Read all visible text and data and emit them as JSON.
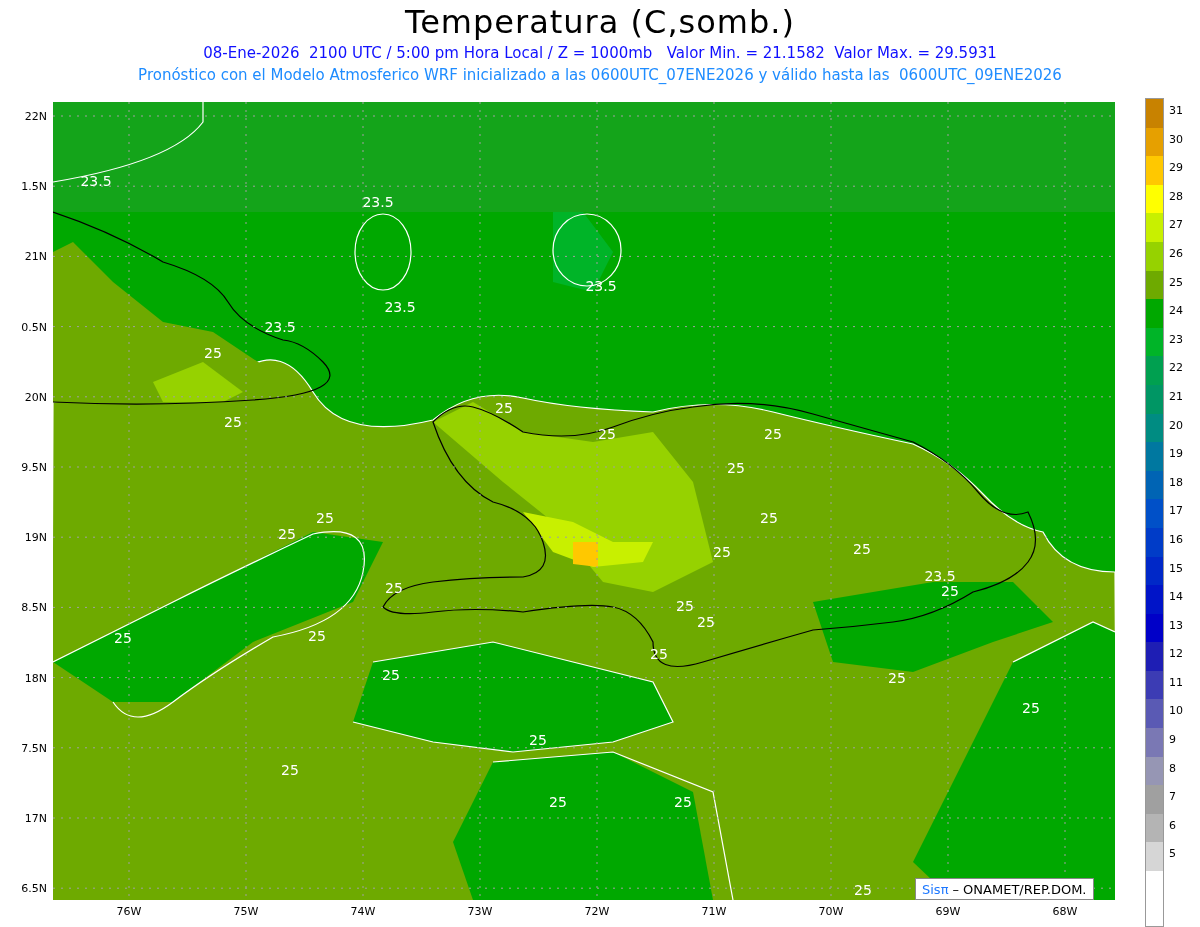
{
  "title": "Temperatura (C,somb.)",
  "subtitle_1": "08-Ene-2026  2100 UTC / 5:00 pm Hora Local / Z = 1000mb   Valor Min. = 21.1582  Valor Max. = 29.5931",
  "subtitle_2": "Pronóstico con el Modelo Atmosferico WRF inicializado a las 0600UTC_07ENE2026 y válido hasta las  0600UTC_09ENE2026",
  "map": {
    "latitude_labels": [
      "22N",
      "1.5N",
      "21N",
      "0.5N",
      "20N",
      "9.5N",
      "19N",
      "8.5N",
      "18N",
      "7.5N",
      "17N",
      "6.5N"
    ],
    "longitude_labels": [
      "76W",
      "75W",
      "74W",
      "73W",
      "72W",
      "71W",
      "70W",
      "69W",
      "68W"
    ],
    "contour_labels": [
      "23.5",
      "23.5",
      "23.5",
      "23.5",
      "23.5",
      "25",
      "25",
      "25",
      "25",
      "25",
      "25",
      "25",
      "25",
      "25",
      "25",
      "25",
      "25",
      "23.5",
      "25",
      "25",
      "25",
      "25",
      "25",
      "25",
      "25",
      "25",
      "25",
      "25",
      "25",
      "25",
      "25",
      "25"
    ]
  },
  "colorbar": [
    {
      "label": "31",
      "color": "#c88200"
    },
    {
      "label": "30",
      "color": "#e6a000"
    },
    {
      "label": "29",
      "color": "#ffc800"
    },
    {
      "label": "28",
      "color": "#ffff00"
    },
    {
      "label": "27",
      "color": "#c8f000"
    },
    {
      "label": "26",
      "color": "#96d200"
    },
    {
      "label": "25",
      "color": "#6eaa00"
    },
    {
      "label": "24",
      "color": "#00a800"
    },
    {
      "label": "23",
      "color": "#00b428"
    },
    {
      "label": "22",
      "color": "#00a050"
    },
    {
      "label": "21",
      "color": "#009664"
    },
    {
      "label": "20",
      "color": "#008c82"
    },
    {
      "label": "19",
      "color": "#0078a0"
    },
    {
      "label": "18",
      "color": "#0064b4"
    },
    {
      "label": "17",
      "color": "#0050c8"
    },
    {
      "label": "16",
      "color": "#003cc8"
    },
    {
      "label": "15",
      "color": "#0028c8"
    },
    {
      "label": "14",
      "color": "#0014c8"
    },
    {
      "label": "13",
      "color": "#0000c8"
    },
    {
      "label": "12",
      "color": "#1e1eb4"
    },
    {
      "label": "11",
      "color": "#3c3cb4"
    },
    {
      "label": "10",
      "color": "#5a5ab4"
    },
    {
      "label": "9",
      "color": "#7a78b4"
    },
    {
      "label": "8",
      "color": "#9696b4"
    },
    {
      "label": "7",
      "color": "#a0a0a0"
    },
    {
      "label": "6",
      "color": "#b4b4b4"
    },
    {
      "label": "5",
      "color": "#d6d6d6"
    }
  ],
  "credit": {
    "brand": "Sisπ",
    "text": "– ONAMET/REP.DOM."
  }
}
